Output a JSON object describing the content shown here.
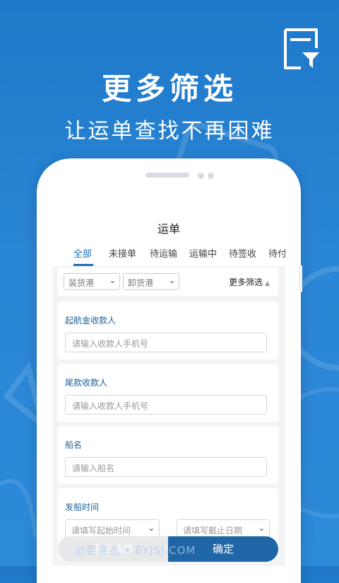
{
  "hero": {
    "title": "更多筛选",
    "subtitle": "让运单查找不再困难"
  },
  "app": {
    "title": "运单",
    "tabs": [
      {
        "label": "全部",
        "active": true
      },
      {
        "label": "未接单"
      },
      {
        "label": "待运输"
      },
      {
        "label": "运输中"
      },
      {
        "label": "待签收"
      },
      {
        "label": "待付"
      }
    ]
  },
  "filter_bar": {
    "load_port": "装货港",
    "unload_port": "卸货港",
    "more": "更多筛选"
  },
  "form": {
    "departure_payee": {
      "label": "起航金收款人",
      "placeholder": "请输入收款人手机号"
    },
    "final_payee": {
      "label": "尾款收款人",
      "placeholder": "请输入收款人手机号"
    },
    "ship_name": {
      "label": "船名",
      "placeholder": "请输入船名"
    },
    "sail_time": {
      "label": "发船时间",
      "start_placeholder": "请填写起始时间",
      "end_placeholder": "请填写截止日期"
    }
  },
  "actions": {
    "clear": "清空条件",
    "confirm": "确定"
  },
  "watermark": "必要筛选 • BYJSJ.COM",
  "colors": {
    "background": "#2a86d6",
    "accent": "#1c6fb8",
    "confirm_button": "#1f66a6"
  },
  "icons": {
    "top_right": "filter-icon",
    "dropdown": "chevron-down-icon",
    "more_toggle": "triangle-up-icon"
  }
}
